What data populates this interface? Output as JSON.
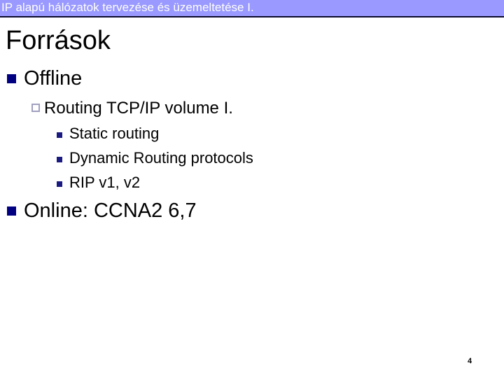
{
  "header": {
    "title": "IP alapú hálózatok tervezése és üzemeltetése I."
  },
  "slide": {
    "title": "Források",
    "items": [
      {
        "label": "Offline",
        "bullet_icon": "filled-square",
        "children": [
          {
            "label": "Routing TCP/IP volume I.",
            "bullet_icon": "hollow-square",
            "children": [
              {
                "label": "Static routing",
                "bullet_icon": "filled-square"
              },
              {
                "label": "Dynamic Routing protocols",
                "bullet_icon": "filled-square"
              },
              {
                "label": "RIP v1, v2",
                "bullet_icon": "filled-square"
              }
            ]
          }
        ]
      },
      {
        "label": "Online: CCNA2 6,7",
        "bullet_icon": "filled-square"
      }
    ],
    "page_number": "4"
  },
  "colors": {
    "header_bg": "#9999ff",
    "header_text": "#ffffff",
    "bullet_primary": "#000080",
    "bullet_hollow": "#a0a0c0"
  }
}
